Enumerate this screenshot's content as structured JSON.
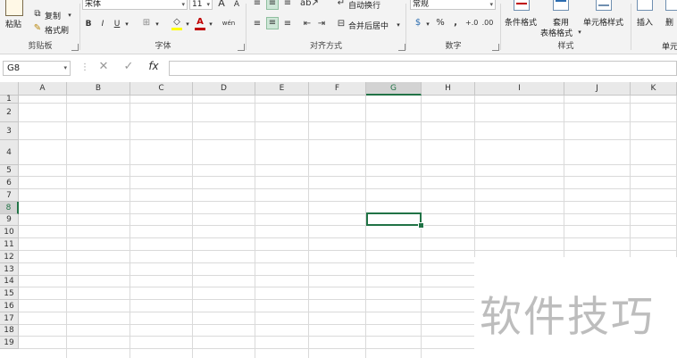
{
  "ribbon": {
    "clipboard": {
      "label": "剪贴板",
      "paste": "粘贴",
      "cut": "剪切",
      "copy": "复制",
      "format_painter": "格式刷"
    },
    "font": {
      "label": "字体",
      "font_name": "宋体",
      "font_size": "11",
      "bold": "B",
      "italic": "I",
      "underline": "U",
      "grow": "A",
      "shrink": "A",
      "phonetic": "wén"
    },
    "alignment": {
      "label": "对齐方式",
      "wrap_text": "自动换行",
      "merge_center": "合并后居中"
    },
    "number": {
      "label": "数字",
      "format": "常规",
      "percent": "%",
      "comma": ","
    },
    "styles": {
      "label": "样式",
      "conditional": "条件格式",
      "table_format_1": "套用",
      "table_format_2": "表格格式",
      "cell_styles": "单元格样式"
    },
    "cells": {
      "label": "单元",
      "insert": "插入",
      "delete": "删"
    }
  },
  "formula_bar": {
    "name_box": "G8",
    "fx": "fx",
    "cancel": "✕",
    "enter": "✓",
    "value": ""
  },
  "columns": [
    "A",
    "B",
    "C",
    "D",
    "E",
    "F",
    "G",
    "H",
    "I",
    "J",
    "K"
  ],
  "rows": [
    "1",
    "2",
    "3",
    "4",
    "5",
    "6",
    "7",
    "8",
    "9",
    "10",
    "11",
    "12",
    "13",
    "14",
    "15",
    "16",
    "17",
    "18",
    "19"
  ],
  "selected_cell": "G8",
  "watermark": "软件技巧",
  "colors": {
    "accent": "#217346",
    "grid": "#dadada",
    "header_bg": "#e9e9e9"
  }
}
